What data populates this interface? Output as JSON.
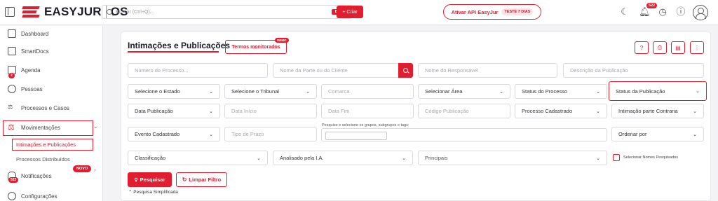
{
  "header": {
    "logo_text": "EASYJUR",
    "logo_suffix": "OS",
    "search_placeholder": "Buscar (Ctrl+Q)...",
    "beta_badge": "BETA",
    "create_label": "+ Criar",
    "api_label": "Ativar API EasyJur",
    "trial_label": "TESTE 7 DIAS",
    "notification_count": "522"
  },
  "sidebar": {
    "items": [
      {
        "label": "Dashboard"
      },
      {
        "label": "SmartDocs"
      },
      {
        "label": "Agenda",
        "badge": "2"
      },
      {
        "label": "Pessoas"
      },
      {
        "label": "Processos e Casos"
      },
      {
        "label": "Movimentações"
      },
      {
        "label": "Notificações",
        "badge": "522"
      },
      {
        "label": "Configurações",
        "badge": "NOVO"
      }
    ],
    "sub_items": [
      {
        "label": "Intimações e Publicações"
      },
      {
        "label": "Processos Distribuídos"
      }
    ]
  },
  "main": {
    "title": "Intimações e Publicações",
    "monitored_terms_label": "Termos monitorados",
    "demo_badge": "DEMO",
    "row1": {
      "process_number": "Número do Processo...",
      "party_name": "Nome da Parte ou do Cliente",
      "responsible": "Nome do Responsável",
      "description": "Descrição da Publicação"
    },
    "row2": {
      "state": "Selecione o Estado",
      "court": "Selecione o Tribunal",
      "comarca": "Comarca",
      "area": "Selecionar Área",
      "process_status": "Status do Processo",
      "publication_status": "Status da Publicação"
    },
    "row3": {
      "publication_date": "Data Publicação",
      "start_date": "Data Início",
      "end_date": "Data Fim",
      "publication_code": "Código Publicação",
      "registered_process": "Processo Cadastrado",
      "opposing_party": "Intimação parte Contraria"
    },
    "row4": {
      "registered_event": "Evento Cadastrado",
      "deadline_type": "Tipo de Prazo",
      "groups_hint": "Pesquise e selecione os grupos, subgrupos e tags:",
      "order_by": "Ordenar por"
    },
    "row5": {
      "classification": "Classificação",
      "ai_analyzed": "Analisado pela I.A.",
      "main": "Principais",
      "select_names_label": "Selecionar Nomes Pesquisados"
    },
    "search_label": "Pesquisar",
    "clear_label": "Limpar Filtro",
    "simplified_label": "Pesquisa Simplificada"
  }
}
